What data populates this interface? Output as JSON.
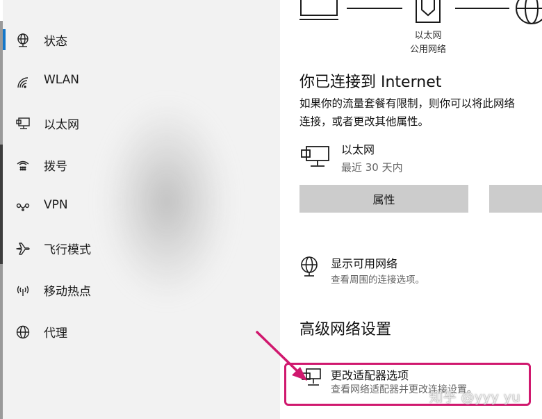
{
  "sidebar": {
    "items": [
      {
        "label": "状态",
        "icon": "status-globe-icon",
        "selected": true
      },
      {
        "label": "WLAN",
        "icon": "wifi-icon",
        "selected": false
      },
      {
        "label": "以太网",
        "icon": "ethernet-icon",
        "selected": false
      },
      {
        "label": "拨号",
        "icon": "dialup-icon",
        "selected": false
      },
      {
        "label": "VPN",
        "icon": "vpn-icon",
        "selected": false
      },
      {
        "label": "飞行模式",
        "icon": "airplane-icon",
        "selected": false
      },
      {
        "label": "移动热点",
        "icon": "hotspot-icon",
        "selected": false
      },
      {
        "label": "代理",
        "icon": "proxy-globe-icon",
        "selected": false
      }
    ],
    "accent": "#1477c9"
  },
  "diagram": {
    "label_line1": "以太网",
    "label_line2": "公用网络"
  },
  "status": {
    "title": "你已连接到 Internet",
    "desc_line1": "如果你的流量套餐有限制，则你可以将此网络",
    "desc_line2": "连接，或者更改其他属性。"
  },
  "connection": {
    "name": "以太网",
    "sub": "最近 30 天内"
  },
  "buttons": {
    "properties": "属性"
  },
  "show_networks": {
    "title": "显示可用网络",
    "sub": "查看周围的连接选项。"
  },
  "advanced": {
    "title": "高级网络设置",
    "adapter_title": "更改适配器选项",
    "adapter_sub": "查看网络适配器并更改连接设置。"
  },
  "annotation_color": "#d0186e",
  "watermark": "知乎 @yyy yu"
}
